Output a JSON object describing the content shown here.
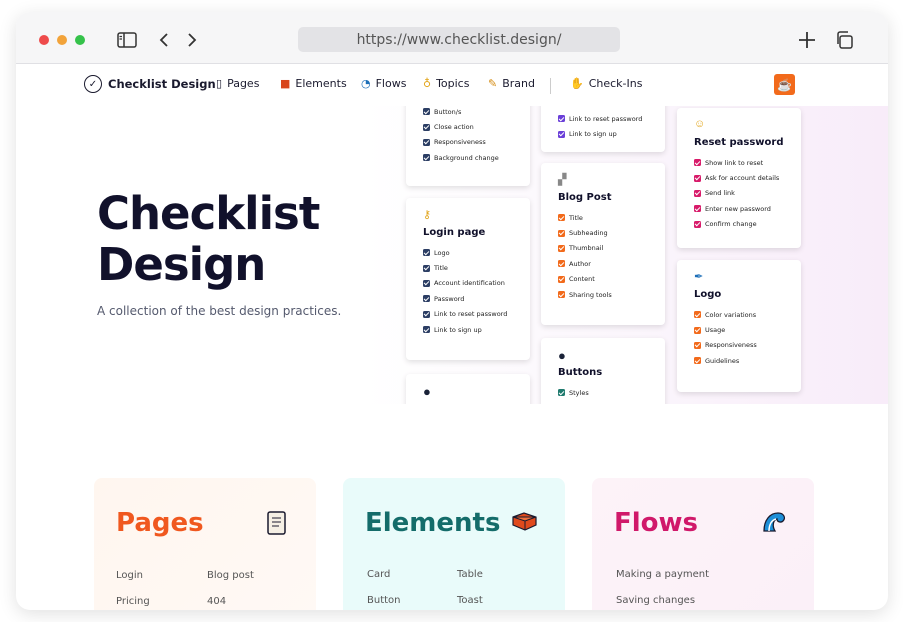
{
  "browser": {
    "url": "https://www.checklist.design/"
  },
  "nav": {
    "brand": "Checklist Design",
    "items": [
      {
        "label": "Pages",
        "icon": "page-icon"
      },
      {
        "label": "Elements",
        "icon": "brick-icon"
      },
      {
        "label": "Flows",
        "icon": "wave-icon"
      },
      {
        "label": "Topics",
        "icon": "bulb-icon"
      },
      {
        "label": "Brand",
        "icon": "pencil-icon"
      },
      {
        "label": "Check-Ins",
        "icon": "wave-hand-icon"
      }
    ],
    "cup_icon": "coffee-cup-icon"
  },
  "hero": {
    "title": "Checklist Design",
    "subtitle": "A collection of the best design practices."
  },
  "cards": [
    {
      "title": "",
      "emoji": "",
      "color": "#2c3e64",
      "items": [
        "Button/s",
        "Close action",
        "Responsiveness",
        "Background change"
      ]
    },
    {
      "title": "Login page",
      "emoji": "🔑",
      "color": "#2c3e64",
      "items": [
        "Logo",
        "Title",
        "Account identification",
        "Password",
        "Link to reset password",
        "Link to sign up"
      ]
    },
    {
      "title": "",
      "emoji": "",
      "color": "#6a3fd8",
      "items": [
        "Link to reset password",
        "Link to sign up"
      ]
    },
    {
      "title": "Blog Post",
      "emoji": "📰",
      "color": "#f26a1b",
      "items": [
        "Title",
        "Subheading",
        "Thumbnail",
        "Author",
        "Content",
        "Sharing tools"
      ]
    },
    {
      "title": "Buttons",
      "emoji": "⚫",
      "color": "#1f7a6e",
      "items": [
        "Styles"
      ]
    },
    {
      "title": "Reset password",
      "emoji": "😯",
      "color": "#d81b6a",
      "items": [
        "Show link to reset",
        "Ask for account details",
        "Send link",
        "Enter new password",
        "Confirm change"
      ]
    },
    {
      "title": "Logo",
      "emoji": "🖊",
      "color": "#f26a1b",
      "items": [
        "Color variations",
        "Usage",
        "Responsiveness",
        "Guidelines"
      ]
    }
  ],
  "sections": [
    {
      "title": "Pages",
      "color": "#f0581f",
      "icon": "scroll-icon",
      "links": [
        "Login",
        "Blog post",
        "Pricing",
        "404"
      ]
    },
    {
      "title": "Elements",
      "color": "#146c6a",
      "icon": "brick-icon",
      "links": [
        "Card",
        "Table",
        "Button",
        "Toast"
      ]
    },
    {
      "title": "Flows",
      "color": "#d0196a",
      "icon": "wave-icon",
      "links": [
        "Making a payment",
        "Saving changes"
      ]
    }
  ]
}
